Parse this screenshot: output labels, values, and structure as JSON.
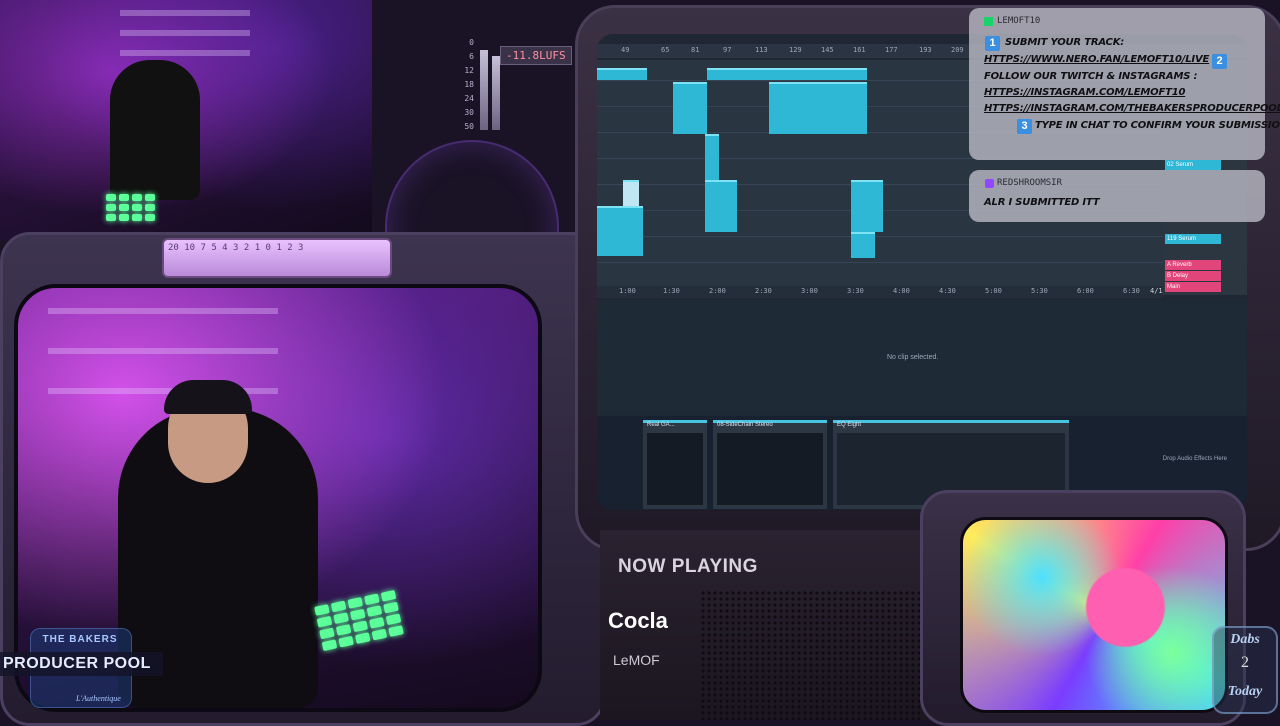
{
  "meter": {
    "lufs": "-11.8LUFS",
    "scale": [
      "0",
      "6",
      "12",
      "18",
      "24",
      "30",
      "50"
    ]
  },
  "dial": {
    "text": "20 10 7 5 4 3 2 1 0 1 2 3"
  },
  "logo": {
    "top": "THE BAKERS",
    "main": "PRODUCER POOL",
    "sub": "L'Authentique"
  },
  "daw": {
    "ruler_marks": [
      "49",
      "65",
      "81",
      "97",
      "113",
      "129",
      "145",
      "161",
      "177",
      "193",
      "209"
    ],
    "time_marks": [
      "1:00",
      "1:30",
      "2:00",
      "2:30",
      "3:00",
      "3:30",
      "4:00",
      "4:30",
      "5:00",
      "5:30",
      "6:00",
      "6:30"
    ],
    "no_clip": "No clip selected.",
    "drop_hint": "Drop Audio Effects Here",
    "tracks": [
      {
        "label": "02 Serum",
        "color": "#2fb7d6"
      },
      {
        "label": "119 Serum",
        "color": "#2fb7d6"
      },
      {
        "label": "A Reverb",
        "color": "#e2457a"
      },
      {
        "label": "B Delay",
        "color": "#e2457a"
      },
      {
        "label": "Main",
        "color": "#e2457a"
      }
    ],
    "devices": [
      {
        "title": "Real GA..."
      },
      {
        "title": "08-SideChain Stereo"
      },
      {
        "title": "EQ Eight"
      }
    ],
    "page": "4/1"
  },
  "chat": {
    "msg1": {
      "user": "LEMOFT10",
      "line1": "SUBMIT YOUR TRACK:",
      "line2": "HTTPS://WWW.NERO.FAN/LEMOFT10/LIVE",
      "line3": "FOLLOW OUR TWITCH & INSTAGRAMS :",
      "line4": "HTTPS://INSTAGRAM.COM/LEMOFT10",
      "line5": "HTTPS://INSTAGRAM.COM/THEBAKERSPRODUCERPOOL",
      "line6": "TYPE IN CHAT TO CONFIRM YOUR SUBMISSION",
      "badge1": "1",
      "badge2": "2",
      "badge3": "3"
    },
    "msg2": {
      "user": "REDSHROOMSIR",
      "line1": "ALR I SUBMITTED ITT"
    }
  },
  "now_playing": {
    "label": "NOW PLAYING",
    "title": "Cocla",
    "artist": "LeMOF"
  },
  "dabs": {
    "line1": "Dabs",
    "line2": "2",
    "line3": "Today"
  },
  "colors": {
    "accent_purple": "#b44cff",
    "clip_blue": "#2fb7d6",
    "badge_blue": "#3a8fe0",
    "chat_bg": "#bebec8"
  }
}
